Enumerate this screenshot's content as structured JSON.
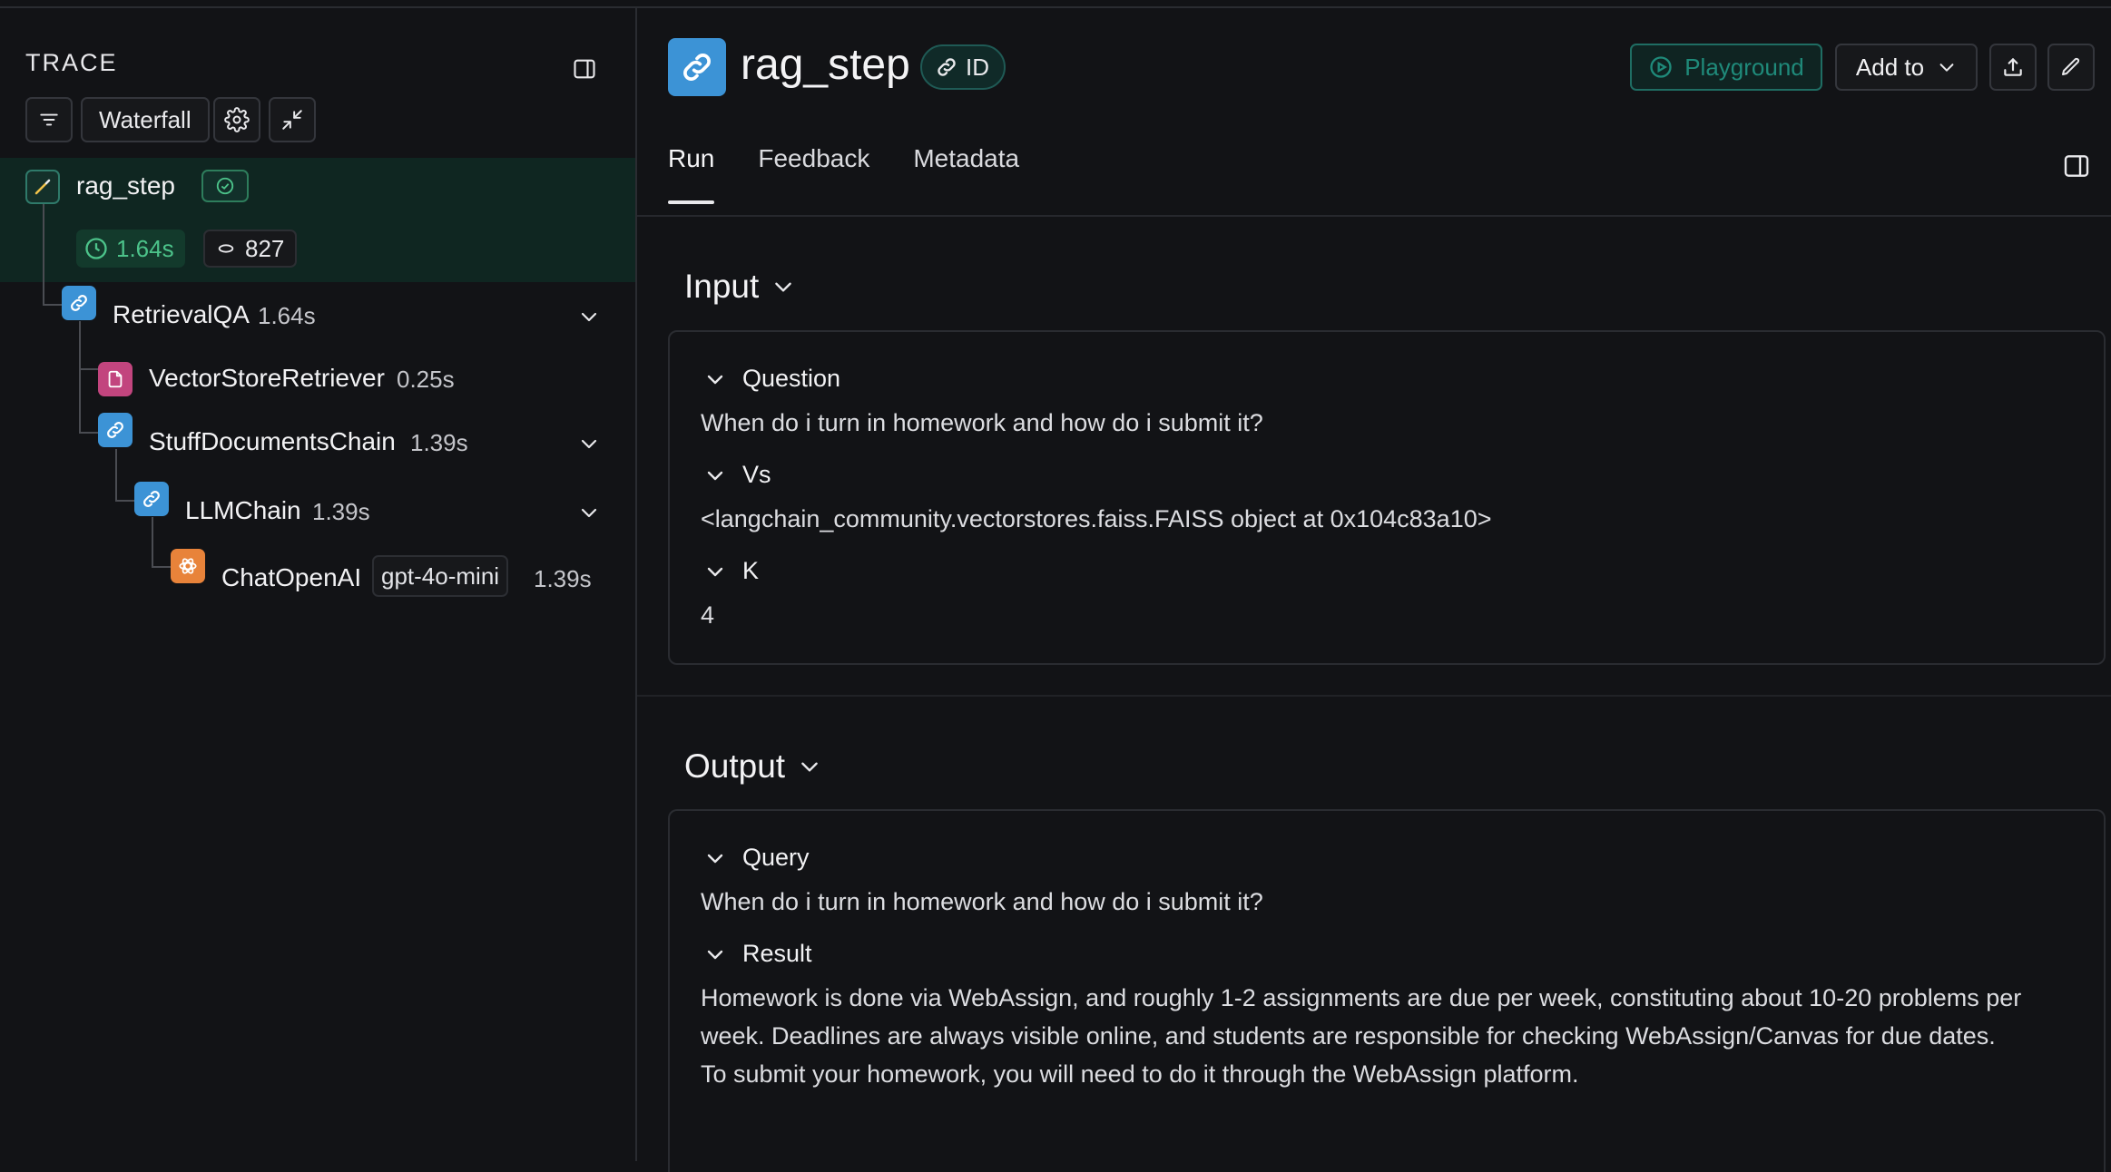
{
  "trace_panel": {
    "title": "TRACE",
    "view_mode": "Waterfall"
  },
  "tree": {
    "root": {
      "name": "rag_step",
      "latency": "1.64s",
      "tokens": "827",
      "status": "success"
    },
    "nodes": [
      {
        "name": "RetrievalQA",
        "time": "1.64s",
        "icon": "link-icon",
        "color": "#3c93d6"
      },
      {
        "name": "VectorStoreRetriever",
        "time": "0.25s",
        "icon": "document-icon",
        "color": "#c2457e"
      },
      {
        "name": "StuffDocumentsChain",
        "time": "1.39s",
        "icon": "link-icon",
        "color": "#3c93d6"
      },
      {
        "name": "LLMChain",
        "time": "1.39s",
        "icon": "link-icon",
        "color": "#3c93d6"
      },
      {
        "name": "ChatOpenAI",
        "model": "gpt-4o-mini",
        "time": "1.39s",
        "icon": "openai-icon",
        "color": "#e8833a"
      }
    ]
  },
  "header": {
    "title": "rag_step",
    "id_label": "ID",
    "playground_label": "Playground",
    "add_to_label": "Add to"
  },
  "tabs": [
    "Run",
    "Feedback",
    "Metadata"
  ],
  "input": {
    "heading": "Input",
    "fields": [
      {
        "key": "Question",
        "value": "When do i turn in homework and how do i submit it?"
      },
      {
        "key": "Vs",
        "value": "<langchain_community.vectorstores.faiss.FAISS object at 0x104c83a10>"
      },
      {
        "key": "K",
        "value": "4"
      }
    ]
  },
  "output": {
    "heading": "Output",
    "fields": [
      {
        "key": "Query",
        "value": "When do i turn in homework and how do i submit it?"
      },
      {
        "key": "Result",
        "value": "Homework is done via WebAssign, and roughly 1-2 assignments are due per week, constituting about 10-20 problems per week. Deadlines are always visible online, and students are responsible for checking WebAssign/Canvas for due dates. To submit your homework, you will need to do it through the WebAssign platform."
      }
    ]
  },
  "colors": {
    "background": "#121316",
    "accent_teal": "#1f8a7a",
    "success_green": "#4cc38a",
    "link_blue": "#3c93d6"
  }
}
